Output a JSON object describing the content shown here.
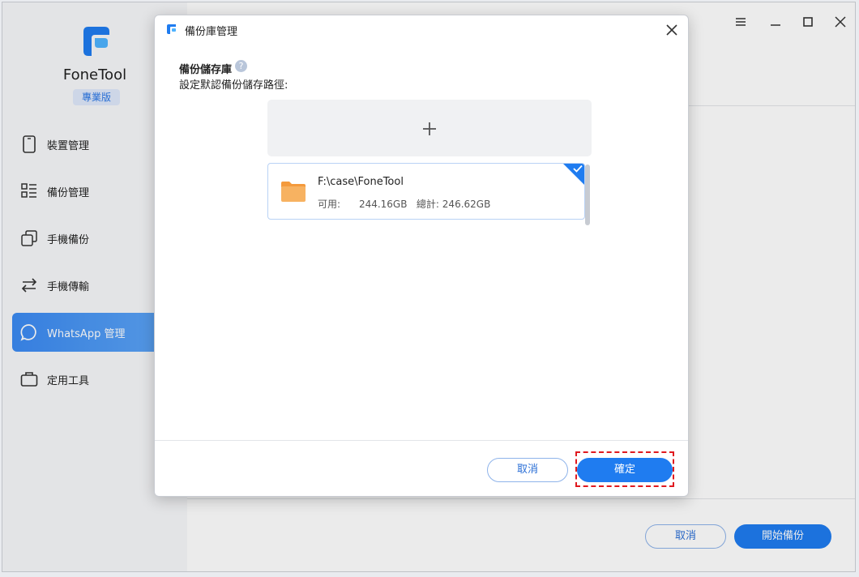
{
  "app": {
    "name": "FoneTool",
    "edition": "專業版"
  },
  "sidebar": {
    "items": [
      {
        "label": "裝置管理",
        "icon": "phone-icon"
      },
      {
        "label": "備份管理",
        "icon": "list-icon"
      },
      {
        "label": "手機備份",
        "icon": "copy-icon"
      },
      {
        "label": "手機傳輸",
        "icon": "transfer-icon"
      },
      {
        "label": "WhatsApp 管理",
        "icon": "whatsapp-icon",
        "active": true
      },
      {
        "label": "定用工具",
        "icon": "toolbox-icon"
      }
    ]
  },
  "window": {
    "controls": [
      "menu-icon",
      "minimize-icon",
      "maximize-icon",
      "close-icon"
    ]
  },
  "main": {
    "cancel_label": "取消",
    "start_label": "開始備份"
  },
  "dialog": {
    "title": "備份庫管理",
    "section_title": "備份儲存庫",
    "help_glyph": "?",
    "section_sub": "設定默認備份儲存路徑:",
    "add_icon": "plus-icon",
    "storage": {
      "path": "F:\\case\\FoneTool",
      "available_label": "可用:",
      "available_value": "244.16GB",
      "total_label": "總計:",
      "total_value": "246.62GB",
      "selected": true
    },
    "cancel_label": "取消",
    "confirm_label": "確定"
  },
  "colors": {
    "accent": "#1f7cf0",
    "highlight": "#e0191f",
    "folder": "#f7a24a"
  }
}
